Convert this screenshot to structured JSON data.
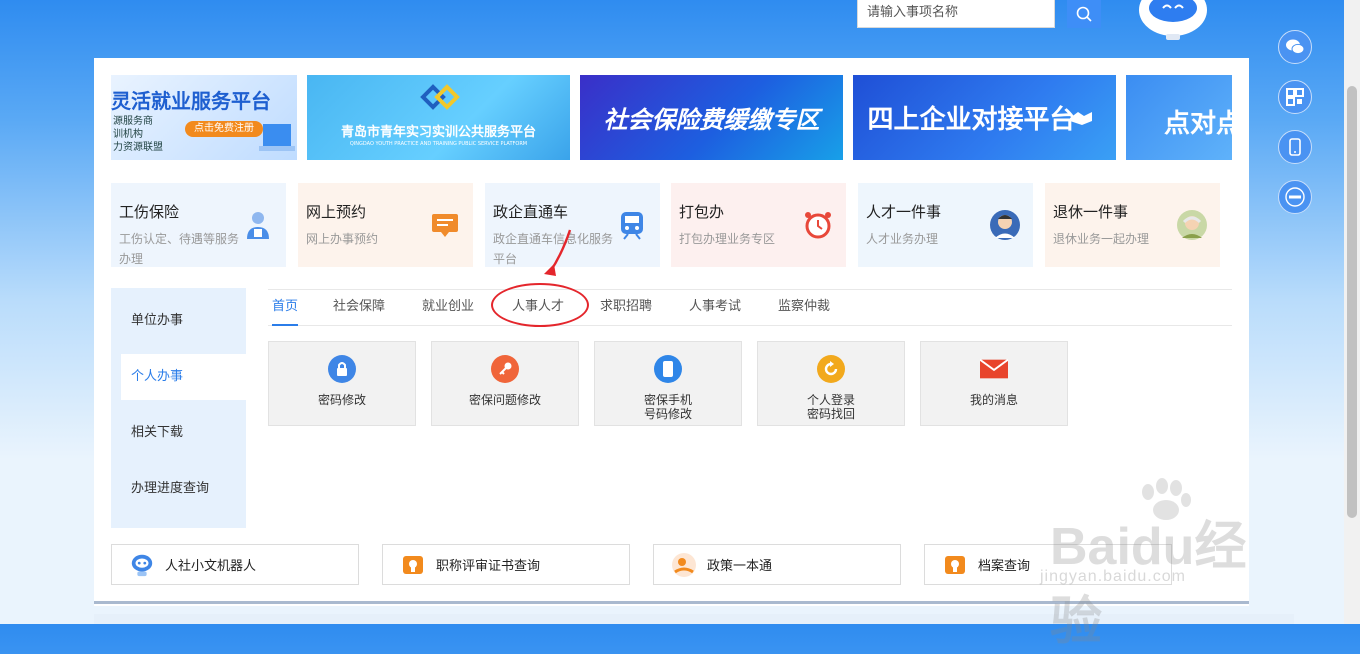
{
  "header": {
    "search_placeholder": "请输入事项名称"
  },
  "banners": [
    {
      "title": "灵活就业服务平台",
      "lines": [
        "源服务商",
        "训机构",
        "力资源联盟"
      ],
      "cta": "点击免费注册"
    },
    {
      "title": "青岛市青年实习实训公共服务平台",
      "subtitle": "QINGDAO YOUTH PRACTICE AND TRAINING PUBLIC SERVICE PLATFORM"
    },
    {
      "title": "社会保险费缓缴专区"
    },
    {
      "title": "四上企业对接平台"
    },
    {
      "title": "点对点"
    }
  ],
  "services": [
    {
      "title": "工伤保险",
      "desc": "工伤认定、待遇等服务办理",
      "bg": "#eef5fd",
      "icon": "worker-icon",
      "accent": "#4a8ee8"
    },
    {
      "title": "网上预约",
      "desc": "网上办事预约",
      "bg": "#fdf3ec",
      "icon": "message-icon",
      "accent": "#f08b2c"
    },
    {
      "title": "政企直通车",
      "desc": "政企直通车信息化服务平台",
      "bg": "#eef5fd",
      "icon": "train-icon",
      "accent": "#3f86e6"
    },
    {
      "title": "打包办",
      "desc": "打包办理业务专区",
      "bg": "#fdf0ef",
      "icon": "alarm-clock-icon",
      "accent": "#e8483a"
    },
    {
      "title": "人才一件事",
      "desc": "人才业务办理",
      "bg": "#eef6fd",
      "icon": "person-icon",
      "accent": "#3a6bb8"
    },
    {
      "title": "退休一件事",
      "desc": "退休业务一起办理",
      "bg": "#fdf3ec",
      "icon": "elder-icon",
      "accent": "#8aa04a"
    }
  ],
  "sidebar": {
    "items": [
      {
        "label": "单位办事"
      },
      {
        "label": "个人办事"
      },
      {
        "label": "相关下载"
      },
      {
        "label": "办理进度查询"
      }
    ],
    "active_index": 1
  },
  "tabs": [
    {
      "label": "首页"
    },
    {
      "label": "社会保障"
    },
    {
      "label": "就业创业"
    },
    {
      "label": "人事人才"
    },
    {
      "label": "求职招聘"
    },
    {
      "label": "人事考试"
    },
    {
      "label": "监察仲裁"
    }
  ],
  "functions": [
    {
      "label": "密码修改",
      "icon": "lock-icon",
      "color": "#3f86e6"
    },
    {
      "label": "密保问题修改",
      "icon": "key-icon",
      "color": "#f0653a"
    },
    {
      "label": "密保手机\n号码修改",
      "icon": "phone-icon",
      "color": "#2f86e8"
    },
    {
      "label": "个人登录\n密码找回",
      "icon": "refresh-icon",
      "color": "#f2a91d"
    },
    {
      "label": "我的消息",
      "icon": "envelope-icon",
      "color": "#e8442c"
    }
  ],
  "quick_links": [
    {
      "label": "人社小文机器人",
      "icon": "robot-icon"
    },
    {
      "label": "职称评审证书查询",
      "icon": "certificate-icon"
    },
    {
      "label": "政策一本通",
      "icon": "policy-book-icon"
    },
    {
      "label": "档案查询",
      "icon": "archive-icon"
    }
  ],
  "float_bar": [
    {
      "icon": "wechat-icon"
    },
    {
      "icon": "qrcode-icon"
    },
    {
      "icon": "mobile-icon"
    },
    {
      "icon": "app-logo-icon"
    }
  ],
  "watermark": {
    "text": "Baidu经验",
    "url": "jingyan.baidu.com"
  },
  "colors": {
    "accent": "#2b7de9",
    "annotation": "#e4262c"
  }
}
